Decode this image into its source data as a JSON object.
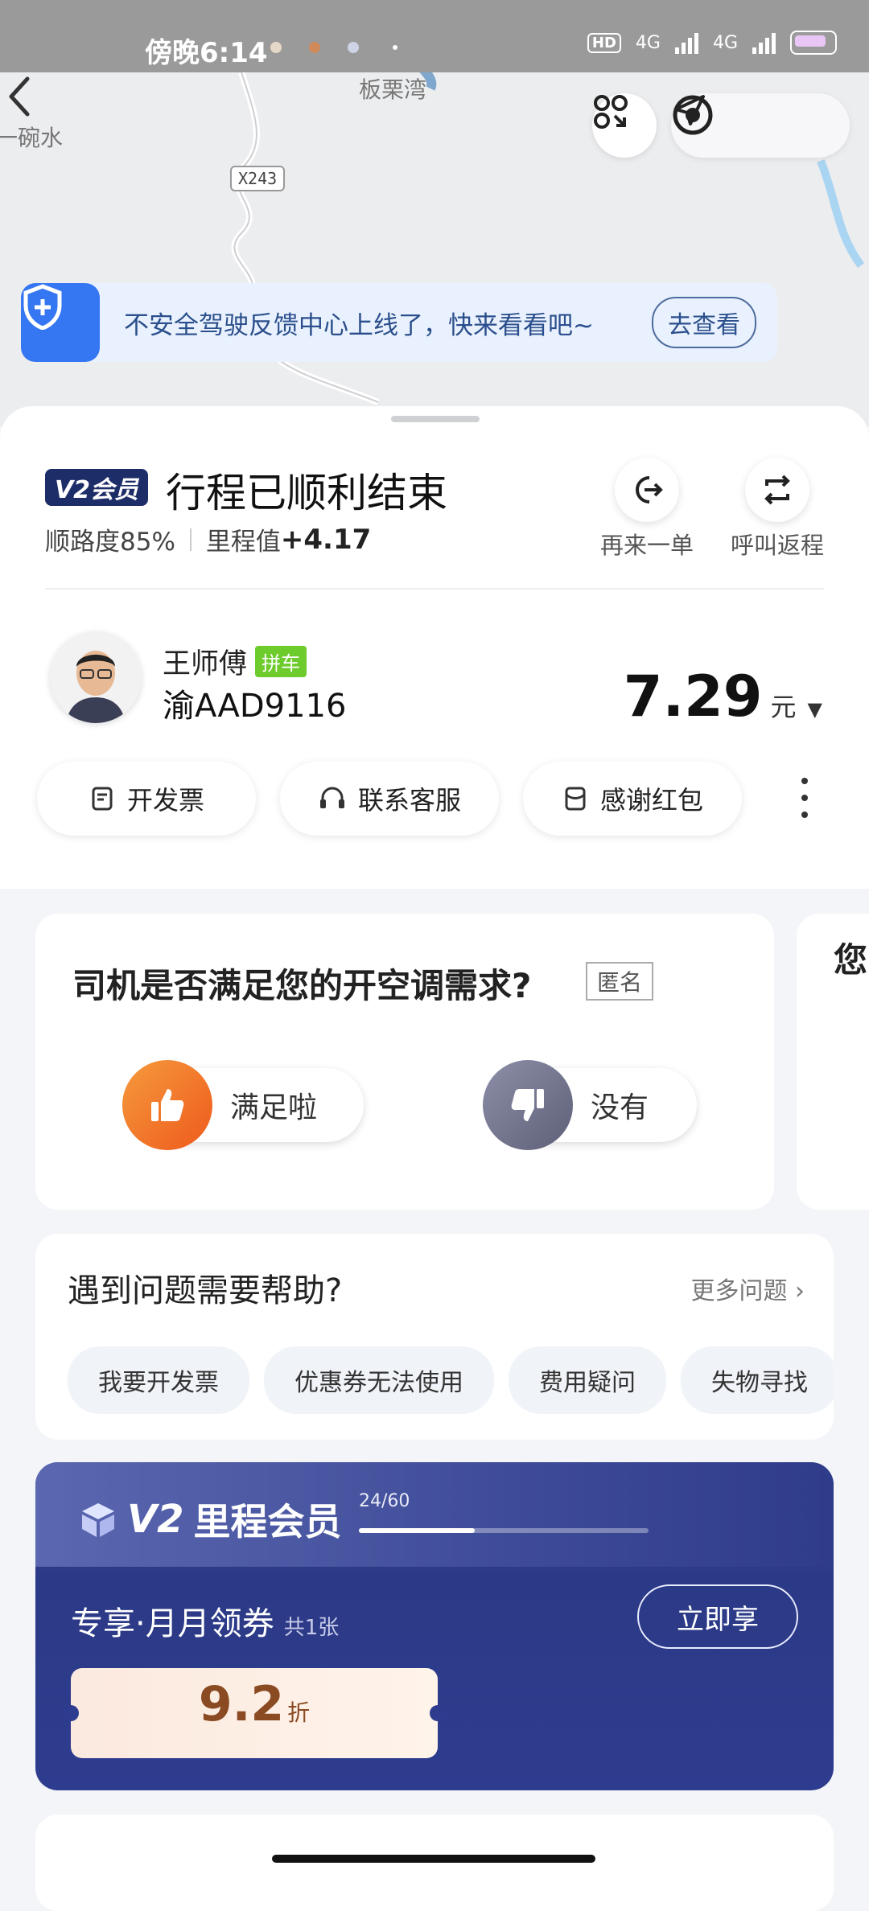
{
  "status_bar": {
    "time": "傍晚6:14",
    "hd": "HD",
    "net1": "4G",
    "net2": "4G"
  },
  "map": {
    "place_label": "板栗湾",
    "left_label": "一碗水",
    "road_tag": "X243"
  },
  "notice": {
    "text": "不安全驾驶反馈中心上线了，快来看看吧~",
    "button": "去查看"
  },
  "trip": {
    "vip_badge": "V2会员",
    "title": "行程已顺利结束",
    "route_label": "顺路度85%",
    "mileage_label": "里程值",
    "mileage_value": "+4.17",
    "again_label": "再来一单",
    "return_label": "呼叫返程"
  },
  "driver": {
    "name": "王师傅",
    "tag": "拼车",
    "plate": "渝AAD9116"
  },
  "fare": {
    "amount": "7.29",
    "unit": "元"
  },
  "actions": {
    "invoice": "开发票",
    "service": "联系客服",
    "tip": "感谢红包"
  },
  "survey": {
    "question": "司机是否满足您的开空调需求?",
    "anonymous": "匿名",
    "yes": "满足啦",
    "no": "没有",
    "peek": "您"
  },
  "help": {
    "title": "遇到问题需要帮助?",
    "more": "更多问题",
    "chips": [
      "我要开发票",
      "优惠券无法使用",
      "费用疑问",
      "失物寻找"
    ]
  },
  "vip_card": {
    "logo_v2": "V2",
    "logo_text": "里程会员",
    "progress_label": "24/60",
    "progress_fraction": 0.4,
    "subtitle": "专享·月月领券",
    "count": "共1张",
    "button": "立即享",
    "discount": "9.2",
    "discount_unit": "折"
  },
  "colors": {
    "accent_blue": "#3576f2",
    "vip_navy": "#2e3c8f",
    "tag_green": "#6dcb2c",
    "thumb_orange": "#f06a1f"
  }
}
